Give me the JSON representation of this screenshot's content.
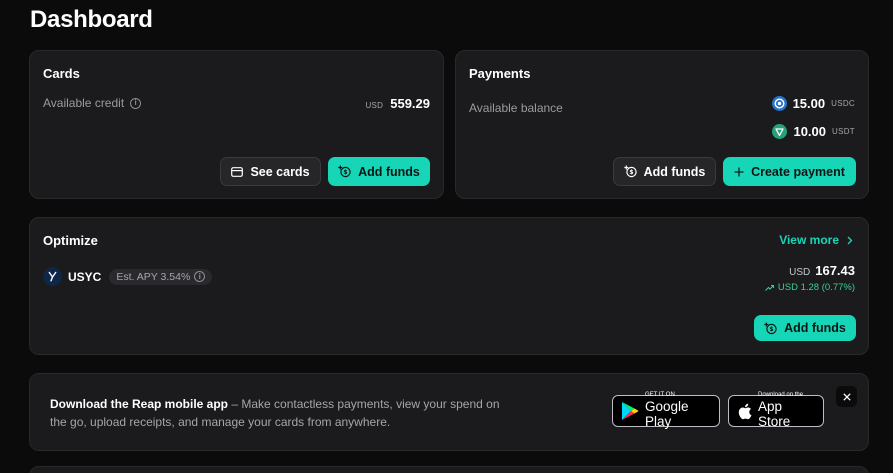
{
  "page": {
    "title": "Dashboard"
  },
  "cards": {
    "title": "Cards",
    "available_label": "Available credit",
    "currency": "USD",
    "amount": "559.29",
    "see_cards_label": "See cards",
    "add_funds_label": "Add funds"
  },
  "payments": {
    "title": "Payments",
    "available_label": "Available balance",
    "balances": [
      {
        "amount": "15.00",
        "currency": "USDC",
        "icon": "usdc-icon",
        "color": "#2775ca"
      },
      {
        "amount": "10.00",
        "currency": "USDT",
        "icon": "usdt-icon",
        "color": "#26a17b"
      }
    ],
    "add_funds_label": "Add funds",
    "create_payment_label": "Create payment"
  },
  "optimize": {
    "title": "Optimize",
    "view_more_label": "View more",
    "asset": {
      "name": "USYC",
      "apy_badge": "Est. APY 3.54%",
      "currency": "USD",
      "amount": "167.43",
      "change": "USD 1.28 (0.77%)"
    },
    "add_funds_label": "Add funds"
  },
  "banner": {
    "title": "Download the Reap mobile app",
    "text": " – Make contactless payments, view your spend on the go, upload receipts, and manage your cards from anywhere.",
    "google_play_small": "GET IT ON",
    "google_play_big": "Google Play",
    "app_store_small": "Download on the",
    "app_store_big": "App Store",
    "close_label": "×"
  },
  "colors": {
    "accent": "#17d6b8",
    "background": "#0b0b0c",
    "card": "#1b1b1d",
    "positive": "#3ecf8e"
  }
}
